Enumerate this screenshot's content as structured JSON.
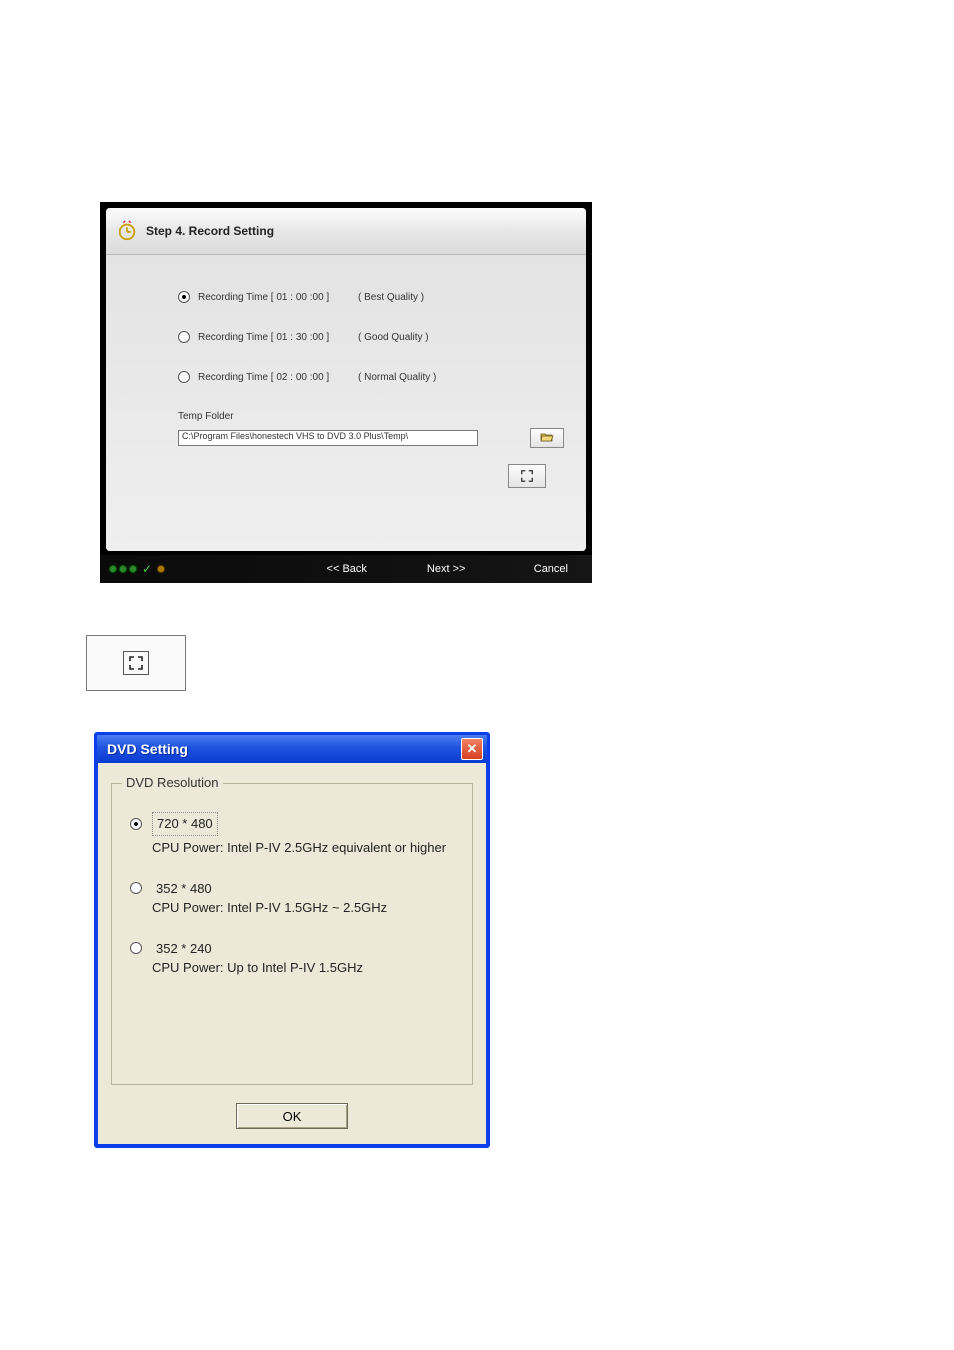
{
  "wizard": {
    "title": "Step 4. Record Setting",
    "options": [
      {
        "label": "Recording Time [ 01 : 00 :00 ]",
        "quality": "( Best Quality )",
        "selected": true
      },
      {
        "label": "Recording Time [ 01 : 30 :00 ]",
        "quality": "( Good Quality )",
        "selected": false
      },
      {
        "label": "Recording Time [ 02 : 00 :00 ]",
        "quality": "( Normal Quality )",
        "selected": false
      }
    ],
    "temp_label": "Temp Folder",
    "temp_path": "C:\\Program Files\\honestech VHS to DVD 3.0 Plus\\Temp\\",
    "back": "<< Back",
    "next": "Next >>",
    "cancel": "Cancel"
  },
  "dvd": {
    "title": "DVD Setting",
    "group": "DVD Resolution",
    "options": [
      {
        "res": "720 * 480",
        "cpu": "CPU Power: Intel P-IV 2.5GHz equivalent or higher",
        "selected": true
      },
      {
        "res": "352 * 480",
        "cpu": "CPU Power: Intel P-IV 1.5GHz ~ 2.5GHz",
        "selected": false
      },
      {
        "res": "352 * 240",
        "cpu": "CPU Power: Up to Intel P-IV 1.5GHz",
        "selected": false
      }
    ],
    "ok": "OK"
  }
}
